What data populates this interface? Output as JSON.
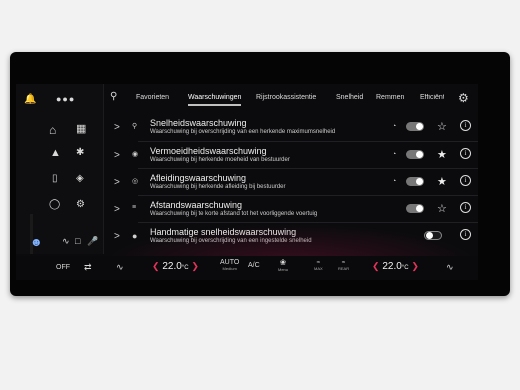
{
  "colors": {
    "accent": "#e2345a",
    "background": "#0b0b0d",
    "text": "#f0f0f0"
  },
  "header": {
    "dots_icon": "more-dots-icon",
    "search_icon": "search-icon",
    "settings_icon": "gear-icon"
  },
  "tabs": [
    {
      "label": "Favorieten",
      "active": false
    },
    {
      "label": "Waarschuwingen",
      "active": true
    },
    {
      "label": "Rijstrookassistentie",
      "active": false
    },
    {
      "label": "Snelheid",
      "active": false
    },
    {
      "label": "Remmen",
      "active": false
    },
    {
      "label": "Efficiënt",
      "active": false
    }
  ],
  "sidebar": {
    "icons": [
      "home-icon",
      "grid-icon",
      "navigation-icon",
      "radio-icon",
      "phone-icon",
      "car-icon",
      "media-icon",
      "car-settings-icon",
      "user-icon",
      "seat-icon",
      "microphone-icon"
    ]
  },
  "items": [
    {
      "title": "Snelheidswaarschuwing",
      "subtitle": "Waarschuwing bij overschrijding van een herkende maximumsnelheid",
      "toggle_on": true,
      "favorite": false
    },
    {
      "title": "Vermoeidheidswaarschuwing",
      "subtitle": "Waarschuwing bij herkende moeheid van bestuurder",
      "toggle_on": true,
      "favorite": true
    },
    {
      "title": "Afleidingswaarschuwing",
      "subtitle": "Waarschuwing bij herkende afleiding bij bestuurder",
      "toggle_on": true,
      "favorite": true
    },
    {
      "title": "Afstandswaarschuwing",
      "subtitle": "Waarschuwing bij te korte afstand tot het voorliggende voertuig",
      "toggle_on": true,
      "favorite": false
    },
    {
      "title": "Handmatige snelheidswaarschuwing",
      "subtitle": "Waarschuwing bij overschrijding van een ingestelde snelheid",
      "toggle_on": false,
      "favorite": false
    }
  ],
  "climate": {
    "off_label": "OFF",
    "temp_left": "22.0",
    "temp_right": "22.0",
    "temp_unit": "°C",
    "auto_label": "AUTO",
    "auto_sub": "Medium",
    "ac_label": "A/C",
    "menu_label": "Menu",
    "max_label": "MAX",
    "rear_label": "REAR"
  }
}
